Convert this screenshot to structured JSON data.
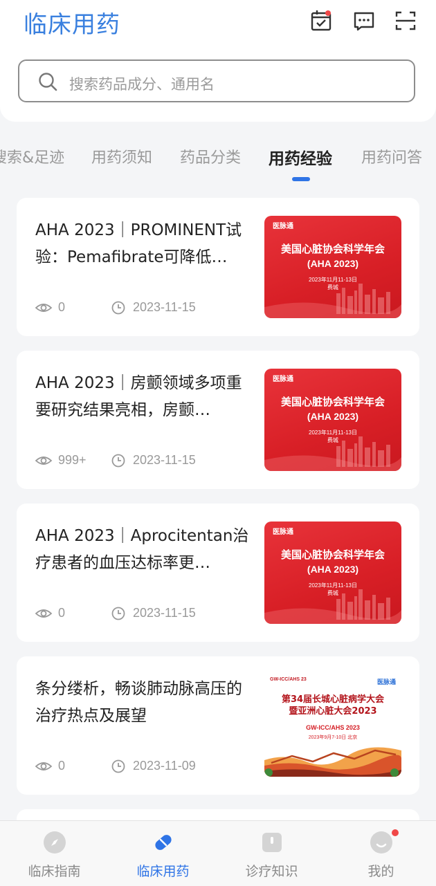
{
  "app": {
    "logo": "临床用药"
  },
  "search": {
    "placeholder": "搜索药品成分、通用名"
  },
  "tabs": [
    {
      "label": "搜索&足迹"
    },
    {
      "label": "用药须知"
    },
    {
      "label": "药品分类"
    },
    {
      "label": "用药经验",
      "active": true
    },
    {
      "label": "用药问答"
    }
  ],
  "articles": [
    {
      "title": "AHA 2023｜PROMINENT试验：Pemafibrate可降低…",
      "views": "0",
      "date": "2023-11-15",
      "thumb": {
        "brand": "医脉通",
        "line1": "美国心脏协会科学年会",
        "line2": "(AHA 2023)",
        "date": "2023年11月11-13日",
        "city": "费城"
      }
    },
    {
      "title": "AHA 2023｜房颤领域多项重要研究结果亮相，房颤…",
      "views": "999+",
      "date": "2023-11-15",
      "thumb": {
        "brand": "医脉通",
        "line1": "美国心脏协会科学年会",
        "line2": "(AHA 2023)",
        "date": "2023年11月11-13日",
        "city": "费城"
      }
    },
    {
      "title": "AHA 2023｜Aprocitentan治疗患者的血压达标率更…",
      "views": "0",
      "date": "2023-11-15",
      "thumb": {
        "brand": "医脉通",
        "line1": "美国心脏协会科学年会",
        "line2": "(AHA 2023)",
        "date": "2023年11月11-13日",
        "city": "费城"
      }
    },
    {
      "title": "条分缕析，畅谈肺动脉高压的治疗热点及展望",
      "views": "0",
      "date": "2023-11-09",
      "thumb": {
        "tag": "GW-ICC/AHS 23",
        "brand": "医脉通",
        "line1": "第34届长城心脏病学大会",
        "line2": "暨亚洲心脏大会2023",
        "line3": "GW-ICC/AHS 2023",
        "date": "2023年9月7-10日 北京"
      }
    }
  ],
  "bottom_nav": [
    {
      "label": "临床指南"
    },
    {
      "label": "临床用药",
      "active": true
    },
    {
      "label": "诊疗知识"
    },
    {
      "label": "我的"
    }
  ],
  "colors": {
    "accent": "#2f74e6",
    "thumb_red": "#d81f26",
    "badge": "#f04848"
  }
}
